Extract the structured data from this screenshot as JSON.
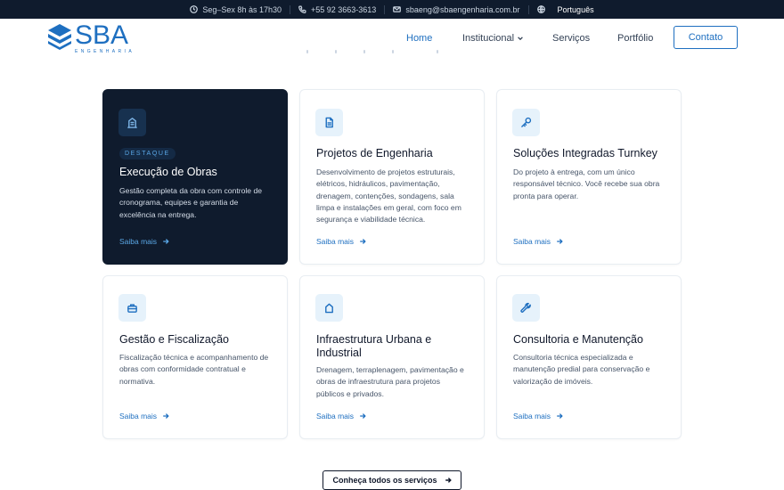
{
  "topbar": {
    "hours": "Seg–Sex 8h às 17h30",
    "phone": "+55 92 3663-3613",
    "email": "sbaeng@sbaengenharia.com.br",
    "language": "Português"
  },
  "logo": {
    "word": "SBA",
    "sub": "ENGENHARIA"
  },
  "nav": {
    "home": "Home",
    "institucional": "Institucional",
    "servicos": "Serviços",
    "portfolio": "Portfólio",
    "contato": "Contato"
  },
  "cards": [
    {
      "icon": "building-icon",
      "badge": "DESTAQUE",
      "title": "Execução de Obras",
      "desc": "Gestão completa da obra com controle de cronograma, equipes e garantia de excelência na entrega.",
      "more": "Saiba mais",
      "featured": true
    },
    {
      "icon": "document-icon",
      "title": "Projetos de Engenharia",
      "desc": "Desenvolvimento de projetos estruturais, elétricos, hidráulicos, pavimentação, drenagem, contenções, sondagens, sala limpa e instalações em geral, com foco em segurança e viabilidade técnica.",
      "more": "Saiba mais"
    },
    {
      "icon": "key-icon",
      "title": "Soluções Integradas Turnkey",
      "desc": "Do projeto à entrega, com um único responsável técnico. Você recebe sua obra pronta para operar.",
      "more": "Saiba mais"
    },
    {
      "icon": "briefcase-icon",
      "title": "Gestão e Fiscalização",
      "desc": "Fiscalização técnica e acompanhamento de obras com conformidade contratual e normativa.",
      "more": "Saiba mais"
    },
    {
      "icon": "home-icon",
      "title": "Infraestrutura Urbana e Industrial",
      "desc": "Drenagem, terraplenagem, pavimentação e obras de infraestrutura para projetos públicos e privados.",
      "more": "Saiba mais"
    },
    {
      "icon": "wrench-icon",
      "title": "Consultoria e Manutenção",
      "desc": "Consultoria técnica especializada e manutenção predial para conservação e valorização de imóveis.",
      "more": "Saiba mais"
    }
  ],
  "cta": {
    "label": "Conheça todos os serviços"
  },
  "colors": {
    "navy": "#0f1b2d",
    "accent": "#1e6fc0"
  }
}
